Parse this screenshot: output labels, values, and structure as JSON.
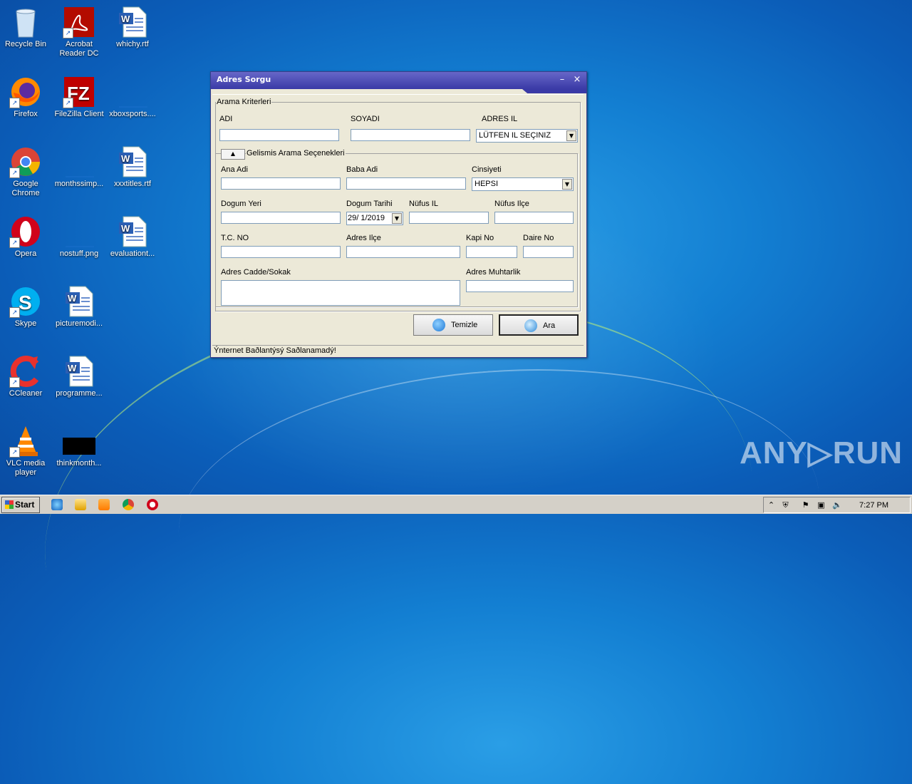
{
  "desktop": {
    "icons": [
      {
        "label": "Recycle Bin",
        "icon": "recycle-bin-icon"
      },
      {
        "label": "Acrobat Reader DC",
        "icon": "acrobat-icon"
      },
      {
        "label": "whichy.rtf",
        "icon": "word-document-icon"
      },
      {
        "label": "Firefox",
        "icon": "firefox-icon"
      },
      {
        "label": "FileZilla Client",
        "icon": "filezilla-icon"
      },
      {
        "label": "xboxsports....",
        "icon": "blank-file-icon"
      },
      {
        "label": "Google Chrome",
        "icon": "chrome-icon"
      },
      {
        "label": "monthssimp...",
        "icon": "blank-file-icon"
      },
      {
        "label": "xxxtitles.rtf",
        "icon": "word-document-icon"
      },
      {
        "label": "Opera",
        "icon": "opera-icon"
      },
      {
        "label": "nostuff.png",
        "icon": "blank-file-icon"
      },
      {
        "label": "evaluationt...",
        "icon": "word-document-icon"
      },
      {
        "label": "Skype",
        "icon": "skype-icon"
      },
      {
        "label": "picturemodi...",
        "icon": "word-document-icon"
      },
      {
        "label": "CCleaner",
        "icon": "ccleaner-icon"
      },
      {
        "label": "programme...",
        "icon": "word-document-icon"
      },
      {
        "label": "VLC media player",
        "icon": "vlc-icon"
      },
      {
        "label": "thinkmonth...",
        "icon": "black-file-icon"
      }
    ]
  },
  "window": {
    "title": "Adres Sorgu",
    "minimize": "–",
    "close": "×",
    "group_main": "Arama Kriterleri",
    "adi_label": "ADI",
    "soyadi_label": "SOYADI",
    "adres_il_label": "ADRES IL",
    "adres_il_value": "LÜTFEN IL SEÇINIZ",
    "group_advanced": "Gelismis Arama Seçenekleri",
    "ana_adi_label": "Ana Adi",
    "baba_adi_label": "Baba Adi",
    "cinsiyeti_label": "Cinsiyeti",
    "cinsiyeti_value": "HEPSI",
    "dogum_yeri_label": "Dogum Yeri",
    "dogum_tarihi_label": "Dogum Tarihi",
    "dogum_tarihi_value": "29/ 1/2019",
    "nufus_il_label": "Nüfus IL",
    "nufus_ilce_label": "Nüfus Ilçe",
    "tc_no_label": "T.C. NO",
    "adres_ilce_label": "Adres Ilçe",
    "kapi_no_label": "Kapi No",
    "daire_no_label": "Daire No",
    "adres_cadde_label": "Adres Cadde/Sokak",
    "adres_muhtarlik_label": "Adres Muhtarlik",
    "temizle_label": "Temizle",
    "ara_label": "Ara",
    "status_text": "Ýnternet Baðlantýsý Saðlanamadý!"
  },
  "taskbar": {
    "start_label": "Start",
    "clock": "7:27 PM"
  },
  "watermark": "ANY▷RUN"
}
